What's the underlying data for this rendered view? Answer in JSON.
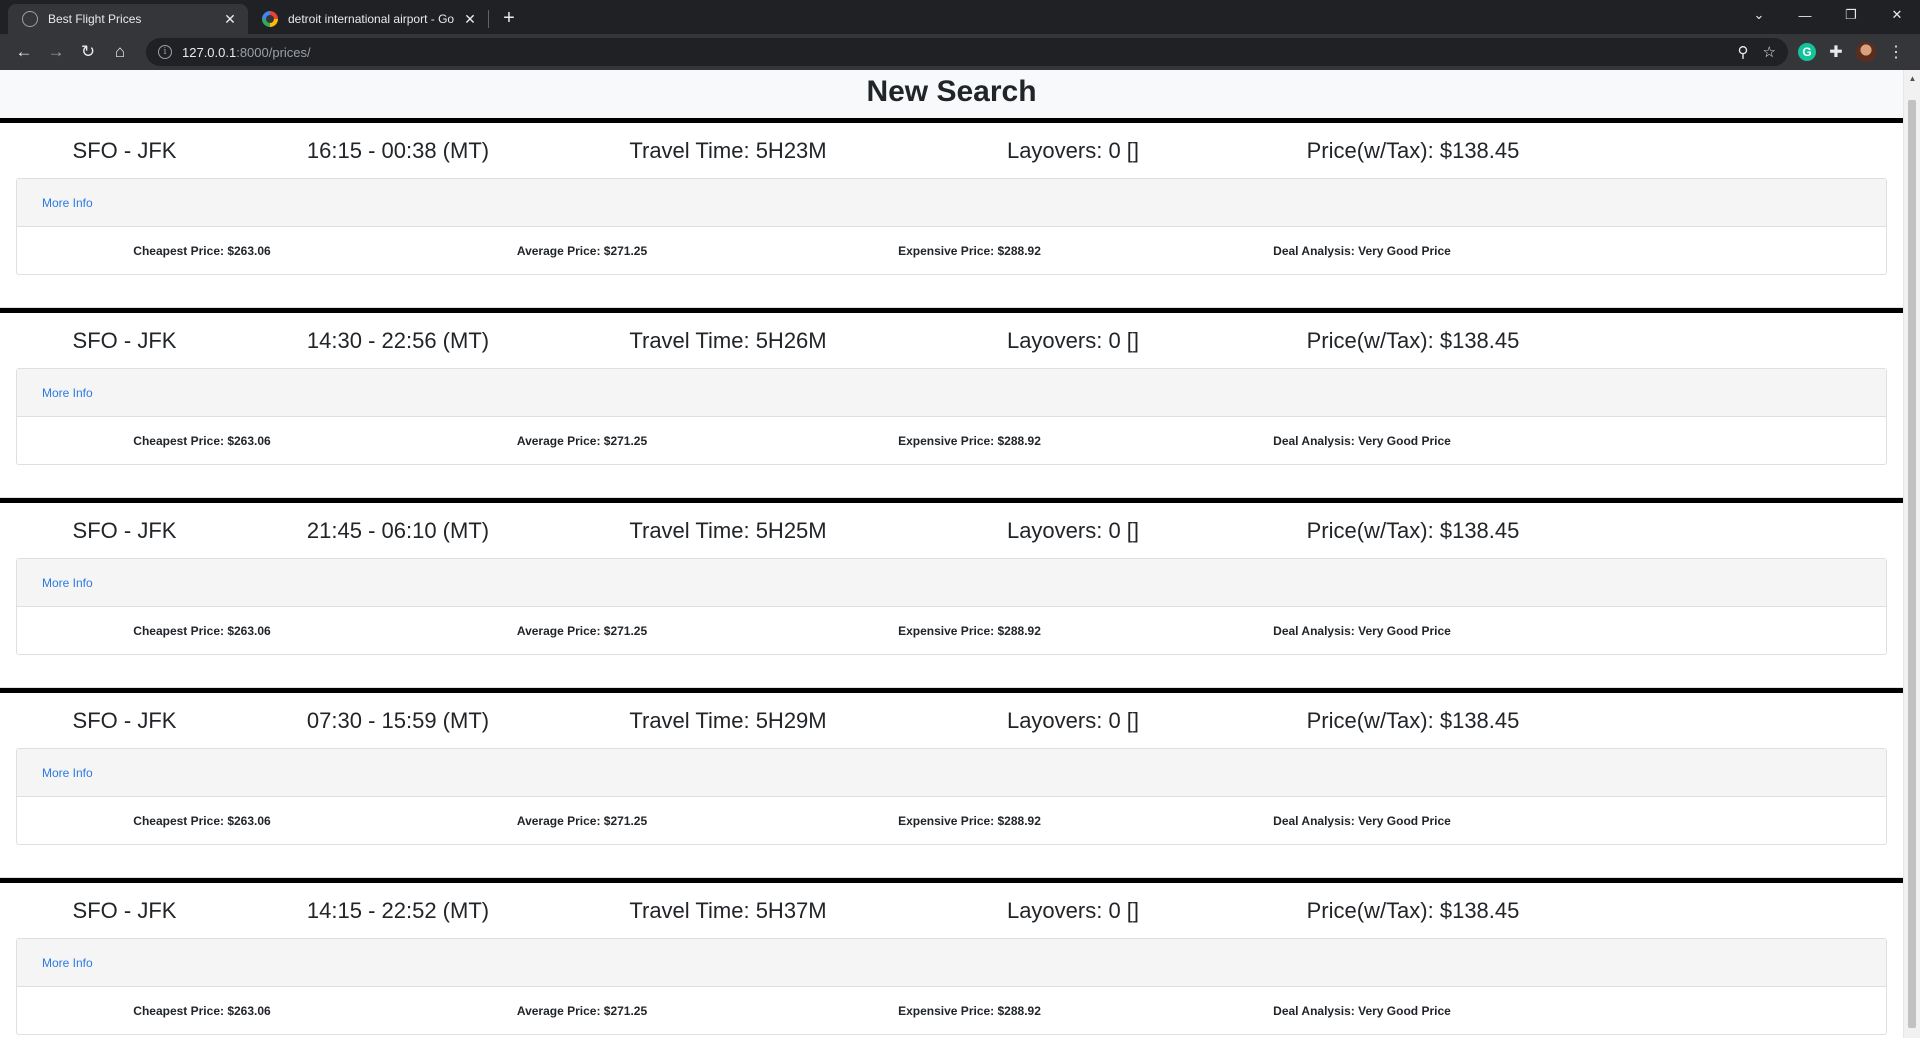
{
  "browser": {
    "tabs": [
      {
        "title": "Best Flight Prices",
        "icon": "globe-icon",
        "active": true
      },
      {
        "title": "detroit international airport - Go",
        "icon": "google-icon",
        "active": false
      }
    ],
    "url_host": "127.0.0.1",
    "url_path": ":8000/prices/"
  },
  "page": {
    "title": "New Search"
  },
  "flights": [
    {
      "route": "SFO - JFK",
      "times": "16:15 - 00:38 (MT)",
      "travel": "Travel Time: 5H23M",
      "layovers": "Layovers: 0 []",
      "price": "Price(w/Tax): $138.45",
      "more": "More Info",
      "cheapest": "Cheapest Price: $263.06",
      "average": "Average Price: $271.25",
      "expensive": "Expensive Price: $288.92",
      "deal": "Deal Analysis: Very Good Price"
    },
    {
      "route": "SFO - JFK",
      "times": "14:30 - 22:56 (MT)",
      "travel": "Travel Time: 5H26M",
      "layovers": "Layovers: 0 []",
      "price": "Price(w/Tax): $138.45",
      "more": "More Info",
      "cheapest": "Cheapest Price: $263.06",
      "average": "Average Price: $271.25",
      "expensive": "Expensive Price: $288.92",
      "deal": "Deal Analysis: Very Good Price"
    },
    {
      "route": "SFO - JFK",
      "times": "21:45 - 06:10 (MT)",
      "travel": "Travel Time: 5H25M",
      "layovers": "Layovers: 0 []",
      "price": "Price(w/Tax): $138.45",
      "more": "More Info",
      "cheapest": "Cheapest Price: $263.06",
      "average": "Average Price: $271.25",
      "expensive": "Expensive Price: $288.92",
      "deal": "Deal Analysis: Very Good Price"
    },
    {
      "route": "SFO - JFK",
      "times": "07:30 - 15:59 (MT)",
      "travel": "Travel Time: 5H29M",
      "layovers": "Layovers: 0 []",
      "price": "Price(w/Tax): $138.45",
      "more": "More Info",
      "cheapest": "Cheapest Price: $263.06",
      "average": "Average Price: $271.25",
      "expensive": "Expensive Price: $288.92",
      "deal": "Deal Analysis: Very Good Price"
    },
    {
      "route": "SFO - JFK",
      "times": "14:15 - 22:52 (MT)",
      "travel": "Travel Time: 5H37M",
      "layovers": "Layovers: 0 []",
      "price": "Price(w/Tax): $138.45",
      "more": "More Info",
      "cheapest": "Cheapest Price: $263.06",
      "average": "Average Price: $271.25",
      "expensive": "Expensive Price: $288.92",
      "deal": "Deal Analysis: Very Good Price"
    }
  ]
}
